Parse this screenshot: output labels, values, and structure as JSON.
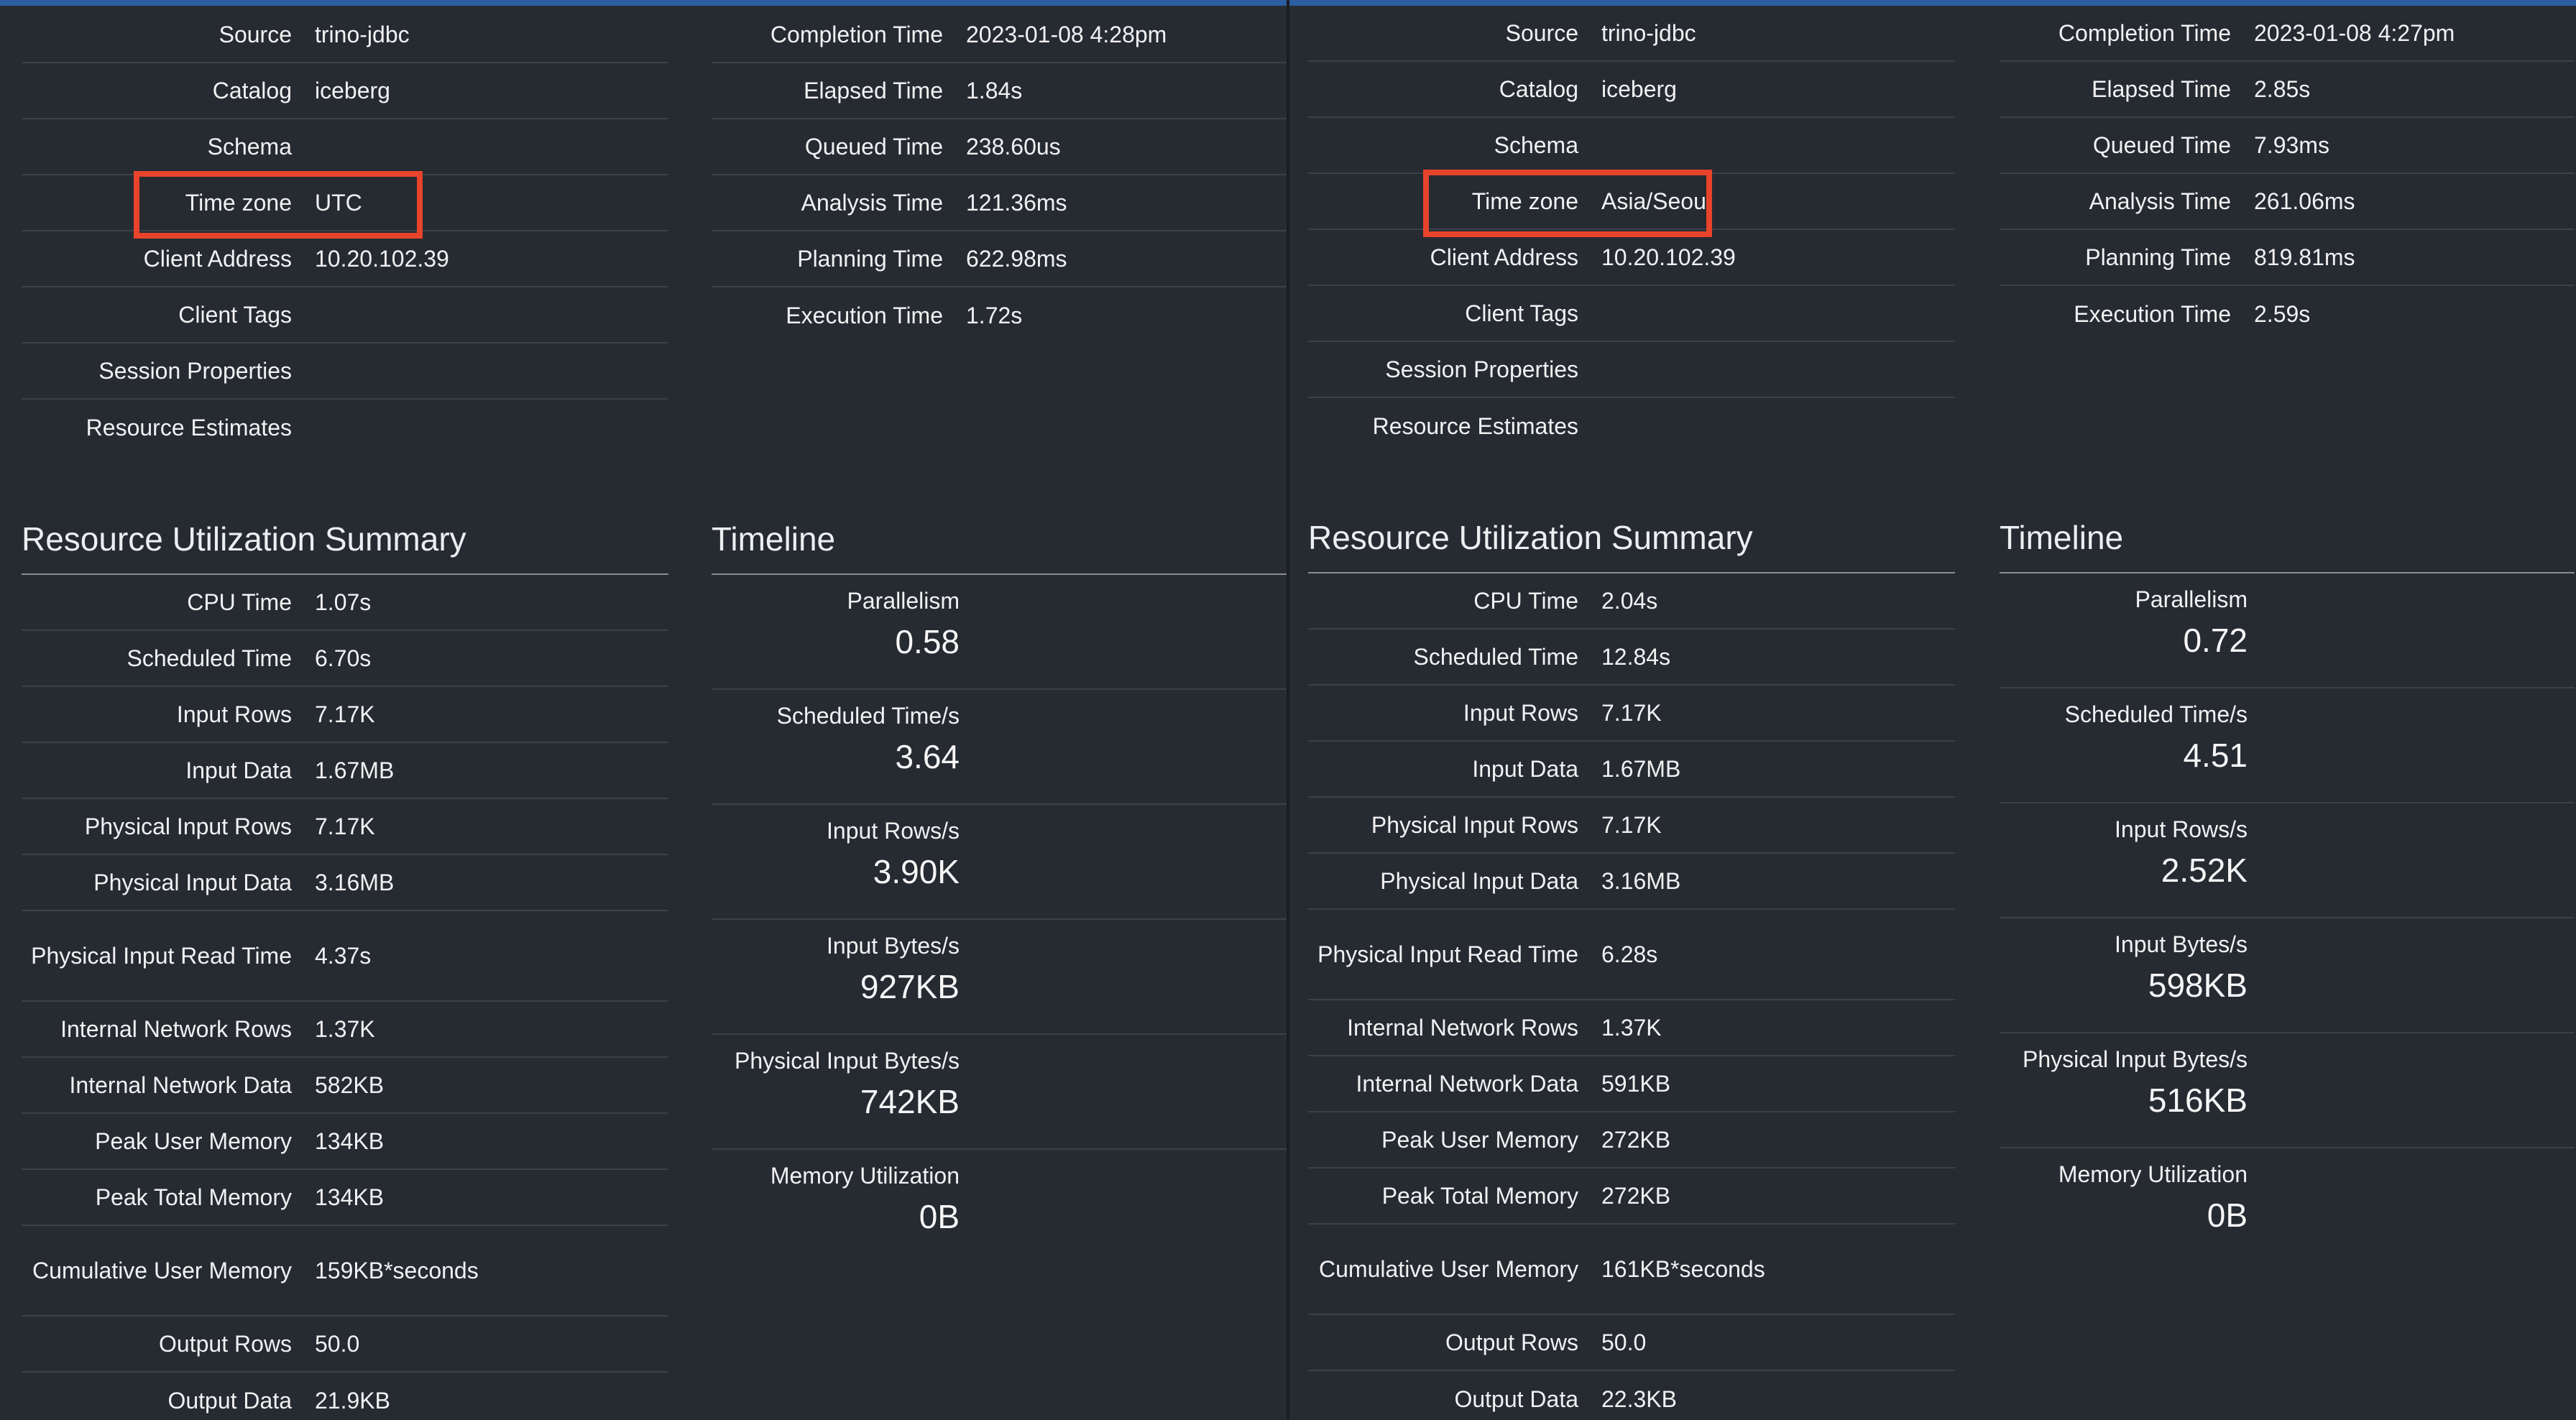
{
  "left": {
    "session": [
      {
        "label": "Source",
        "value": "trino-jdbc"
      },
      {
        "label": "Catalog",
        "value": "iceberg"
      },
      {
        "label": "Schema",
        "value": ""
      },
      {
        "label": "Time zone",
        "value": "UTC"
      },
      {
        "label": "Client Address",
        "value": "10.20.102.39"
      },
      {
        "label": "Client Tags",
        "value": ""
      },
      {
        "label": "Session Properties",
        "value": ""
      },
      {
        "label": "Resource Estimates",
        "value": ""
      }
    ],
    "times": [
      {
        "label": "Completion Time",
        "value": "2023-01-08 4:28pm"
      },
      {
        "label": "Elapsed Time",
        "value": "1.84s"
      },
      {
        "label": "Queued Time",
        "value": "238.60us"
      },
      {
        "label": "Analysis Time",
        "value": "121.36ms"
      },
      {
        "label": "Planning Time",
        "value": "622.98ms"
      },
      {
        "label": "Execution Time",
        "value": "1.72s"
      }
    ],
    "resource_title": "Resource Utilization Summary",
    "resources": [
      {
        "label": "CPU Time",
        "value": "1.07s"
      },
      {
        "label": "Scheduled Time",
        "value": "6.70s"
      },
      {
        "label": "Input Rows",
        "value": "7.17K"
      },
      {
        "label": "Input Data",
        "value": "1.67MB"
      },
      {
        "label": "Physical Input Rows",
        "value": "7.17K"
      },
      {
        "label": "Physical Input Data",
        "value": "3.16MB"
      },
      {
        "label": "Physical Input Read Time",
        "value": "4.37s"
      },
      {
        "label": "Internal Network Rows",
        "value": "1.37K"
      },
      {
        "label": "Internal Network Data",
        "value": "582KB"
      },
      {
        "label": "Peak User Memory",
        "value": "134KB"
      },
      {
        "label": "Peak Total Memory",
        "value": "134KB"
      },
      {
        "label": "Cumulative User Memory",
        "value": "159KB*seconds"
      },
      {
        "label": "Output Rows",
        "value": "50.0"
      },
      {
        "label": "Output Data",
        "value": "21.9KB"
      }
    ],
    "timeline_title": "Timeline",
    "timeline": [
      {
        "label": "Parallelism",
        "value": "0.58"
      },
      {
        "label": "Scheduled Time/s",
        "value": "3.64"
      },
      {
        "label": "Input Rows/s",
        "value": "3.90K"
      },
      {
        "label": "Input Bytes/s",
        "value": "927KB"
      },
      {
        "label": "Physical Input Bytes/s",
        "value": "742KB"
      },
      {
        "label": "Memory Utilization",
        "value": "0B"
      }
    ]
  },
  "right": {
    "session": [
      {
        "label": "Source",
        "value": "trino-jdbc"
      },
      {
        "label": "Catalog",
        "value": "iceberg"
      },
      {
        "label": "Schema",
        "value": ""
      },
      {
        "label": "Time zone",
        "value": "Asia/Seoul"
      },
      {
        "label": "Client Address",
        "value": "10.20.102.39"
      },
      {
        "label": "Client Tags",
        "value": ""
      },
      {
        "label": "Session Properties",
        "value": ""
      },
      {
        "label": "Resource Estimates",
        "value": ""
      }
    ],
    "times": [
      {
        "label": "Completion Time",
        "value": "2023-01-08 4:27pm"
      },
      {
        "label": "Elapsed Time",
        "value": "2.85s"
      },
      {
        "label": "Queued Time",
        "value": "7.93ms"
      },
      {
        "label": "Analysis Time",
        "value": "261.06ms"
      },
      {
        "label": "Planning Time",
        "value": "819.81ms"
      },
      {
        "label": "Execution Time",
        "value": "2.59s"
      }
    ],
    "resource_title": "Resource Utilization Summary",
    "resources": [
      {
        "label": "CPU Time",
        "value": "2.04s"
      },
      {
        "label": "Scheduled Time",
        "value": "12.84s"
      },
      {
        "label": "Input Rows",
        "value": "7.17K"
      },
      {
        "label": "Input Data",
        "value": "1.67MB"
      },
      {
        "label": "Physical Input Rows",
        "value": "7.17K"
      },
      {
        "label": "Physical Input Data",
        "value": "3.16MB"
      },
      {
        "label": "Physical Input Read Time",
        "value": "6.28s"
      },
      {
        "label": "Internal Network Rows",
        "value": "1.37K"
      },
      {
        "label": "Internal Network Data",
        "value": "591KB"
      },
      {
        "label": "Peak User Memory",
        "value": "272KB"
      },
      {
        "label": "Peak Total Memory",
        "value": "272KB"
      },
      {
        "label": "Cumulative User Memory",
        "value": "161KB*seconds"
      },
      {
        "label": "Output Rows",
        "value": "50.0"
      },
      {
        "label": "Output Data",
        "value": "22.3KB"
      }
    ],
    "timeline_title": "Timeline",
    "timeline": [
      {
        "label": "Parallelism",
        "value": "0.72"
      },
      {
        "label": "Scheduled Time/s",
        "value": "4.51"
      },
      {
        "label": "Input Rows/s",
        "value": "2.52K"
      },
      {
        "label": "Input Bytes/s",
        "value": "598KB"
      },
      {
        "label": "Physical Input Bytes/s",
        "value": "516KB"
      },
      {
        "label": "Memory Utilization",
        "value": "0B"
      }
    ]
  },
  "highlight_color": "#e8432b"
}
